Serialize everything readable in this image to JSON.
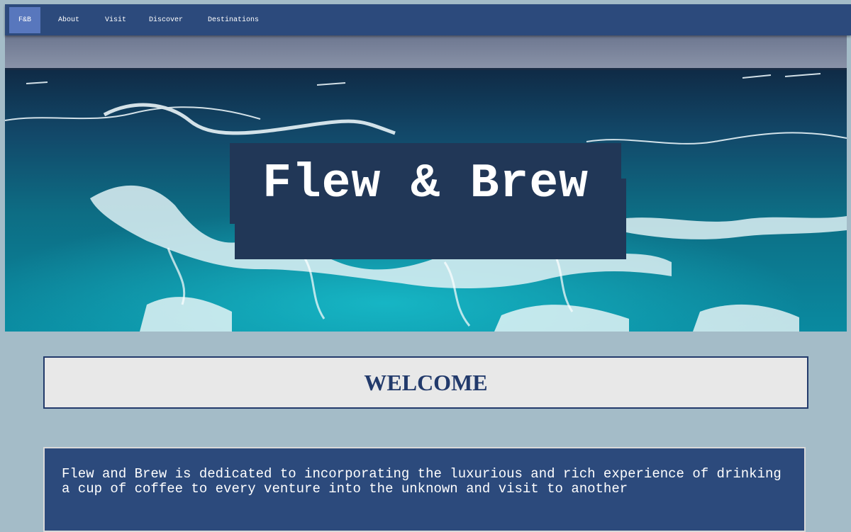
{
  "nav": {
    "items": [
      {
        "label": "F&B"
      },
      {
        "label": "About"
      },
      {
        "label": "Visit"
      },
      {
        "label": "Discover"
      },
      {
        "label": "Destinations"
      }
    ]
  },
  "hero": {
    "title": "Flew & Brew",
    "image": "ocean-waves"
  },
  "welcome": {
    "heading": "WELCOME"
  },
  "about": {
    "text": "Flew and Brew is dedicated to incorporating the luxurious and rich experience of drinking a cup of coffee to every venture into the unknown and visit to another"
  },
  "colors": {
    "background": "#a4bcc8",
    "nav": "#2c4a7c",
    "nav_active": "#5877bd",
    "hero_title_bg": "#213757",
    "welcome_bg": "#e8e8e8",
    "accent": "#223a6b"
  }
}
